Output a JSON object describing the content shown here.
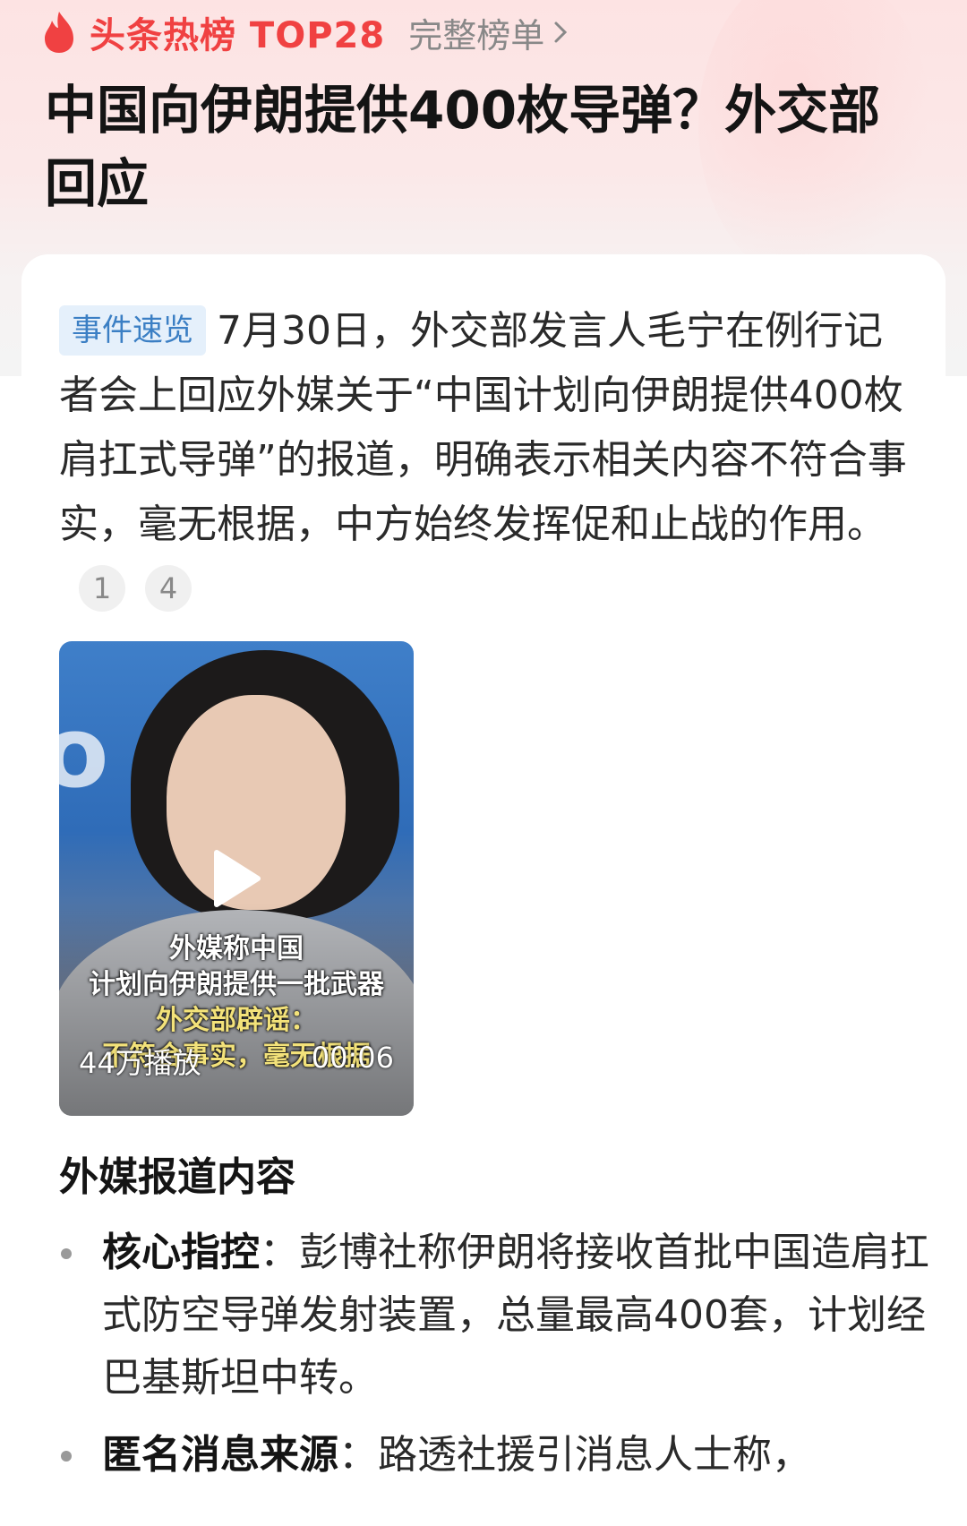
{
  "hot_header": {
    "brand": "头条热榜 TOP28",
    "full_list_label": "完整榜单"
  },
  "title": "中国向伊朗提供400枚导弹？外交部回应",
  "summary": {
    "tag": "事件速览",
    "text": "7月30日，外交部发言人毛宁在例行记者会上回应外媒关于“中国计划向伊朗提供400枚肩扛式导弹”的报道，明确表示相关内容不符合事实，毫无根据，中方始终发挥促和止战的作用。",
    "refs": [
      "1",
      "4"
    ]
  },
  "video": {
    "caption_lines": [
      "外媒称中国",
      "计划向伊朗提供一批武器",
      "外交部辟谣：",
      "不符合事实，毫无根据"
    ],
    "play_count": "44万播放",
    "duration": "00:06"
  },
  "section": {
    "title": "外媒报道内容",
    "bullets": [
      {
        "lead": "核心指控",
        "sep": "：",
        "text": "彭博社称伊朗将接收首批中国造肩扛式防空导弹发射装置，总量最高400套，计划经巴基斯坦中转。"
      },
      {
        "lead": "匿名消息来源",
        "sep": "：",
        "text": "路透社援引消息人士称，"
      }
    ]
  },
  "colors": {
    "brand_red": "#f04142",
    "tag_bg": "#e5f0fb",
    "tag_text": "#3b7fc4"
  }
}
